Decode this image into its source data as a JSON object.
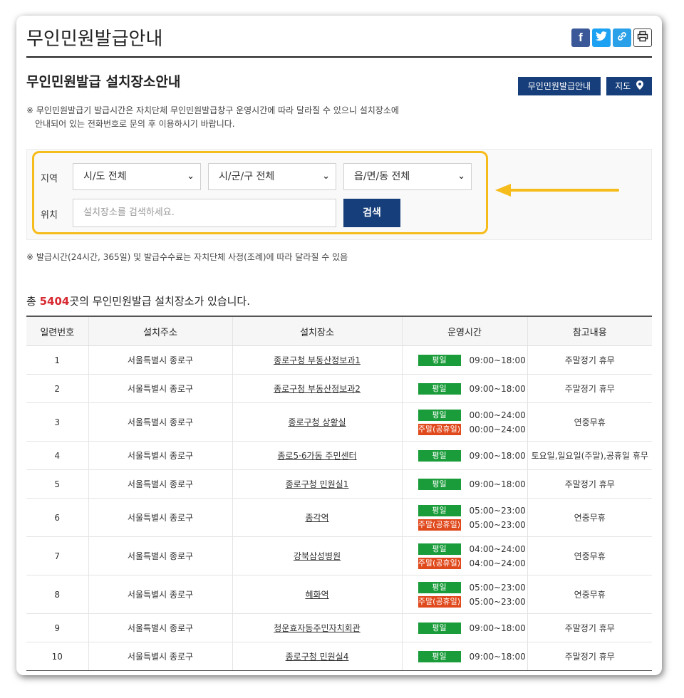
{
  "header": {
    "title": "무인민원발급안내"
  },
  "share": {
    "facebook": "f",
    "twitter": "t",
    "link": "🔗",
    "print": "🖨"
  },
  "section": {
    "title": "무인민원발급 설치장소안내"
  },
  "buttons": {
    "guide": "무인민원발급안내",
    "map": "지도"
  },
  "notice": {
    "line1": "※ 무인민원발급기 발급시간은 자치단체 무인민원발급창구 운영시간에 따라 달라질 수 있으니 설치장소에",
    "line2": "안내되어 있는 전화번호로 문의 후 이용하시기 바랍니다."
  },
  "search": {
    "region_label": "지역",
    "location_label": "위치",
    "sido": "시/도 전체",
    "sigungu": "시/군/구 전체",
    "eupmyeondong": "읍/면/동 전체",
    "placeholder": "설치장소를 검색하세요.",
    "button": "검색"
  },
  "note2": "※ 발급시간(24시간, 365일) 및 발급수수료는 자치단체 사정(조례)에 따라 달라질 수 있음",
  "total": {
    "prefix": "총 ",
    "count": "5404",
    "suffix": "곳의 무인민원발급 설치장소가 있습니다."
  },
  "table": {
    "headers": [
      "일련번호",
      "설치주소",
      "설치장소",
      "운영시간",
      "참고내용"
    ],
    "rows": [
      {
        "no": "1",
        "addr": "서울특별시 종로구",
        "place": "종로구청 부동산정보과1",
        "hours": [
          {
            "type": "평일",
            "time": "09:00~18:00"
          }
        ],
        "note": "주말정기 휴무"
      },
      {
        "no": "2",
        "addr": "서울특별시 종로구",
        "place": "종로구청 부동산정보과2",
        "hours": [
          {
            "type": "평일",
            "time": "09:00~18:00"
          }
        ],
        "note": "주말정기 휴무"
      },
      {
        "no": "3",
        "addr": "서울특별시 종로구",
        "place": "종로구청 상황실",
        "hours": [
          {
            "type": "평일",
            "time": "00:00~24:00"
          },
          {
            "type": "주말(공휴일)",
            "time": "00:00~24:00"
          }
        ],
        "note": "연중무휴"
      },
      {
        "no": "4",
        "addr": "서울특별시 종로구",
        "place": "종로5·6가동 주민센터",
        "hours": [
          {
            "type": "평일",
            "time": "09:00~18:00"
          }
        ],
        "note": "토요일,일요일(주말),공휴일 휴무"
      },
      {
        "no": "5",
        "addr": "서울특별시 종로구",
        "place": "종로구청 민원실1",
        "hours": [
          {
            "type": "평일",
            "time": "09:00~18:00"
          }
        ],
        "note": "주말정기 휴무"
      },
      {
        "no": "6",
        "addr": "서울특별시 종로구",
        "place": "종각역",
        "hours": [
          {
            "type": "평일",
            "time": "05:00~23:00"
          },
          {
            "type": "주말(공휴일)",
            "time": "05:00~23:00"
          }
        ],
        "note": "연중무휴"
      },
      {
        "no": "7",
        "addr": "서울특별시 종로구",
        "place": "강북삼성병원",
        "hours": [
          {
            "type": "평일",
            "time": "04:00~24:00"
          },
          {
            "type": "주말(공휴일)",
            "time": "04:00~24:00"
          }
        ],
        "note": "연중무휴"
      },
      {
        "no": "8",
        "addr": "서울특별시 종로구",
        "place": "혜화역",
        "hours": [
          {
            "type": "평일",
            "time": "05:00~23:00"
          },
          {
            "type": "주말(공휴일)",
            "time": "05:00~23:00"
          }
        ],
        "note": "연중무휴"
      },
      {
        "no": "9",
        "addr": "서울특별시 종로구",
        "place": "청운효자동주민자치회관",
        "hours": [
          {
            "type": "평일",
            "time": "09:00~18:00"
          }
        ],
        "note": "주말정기 휴무"
      },
      {
        "no": "10",
        "addr": "서울특별시 종로구",
        "place": "종로구청 민원실4",
        "hours": [
          {
            "type": "평일",
            "time": "09:00~18:00"
          }
        ],
        "note": "주말정기 휴무"
      }
    ]
  },
  "colors": {
    "navy": "#163e7a",
    "accent_red": "#d7282f",
    "badge_green": "#1a9c3a",
    "badge_red": "#e0491c",
    "highlight": "#f6bc1b"
  }
}
